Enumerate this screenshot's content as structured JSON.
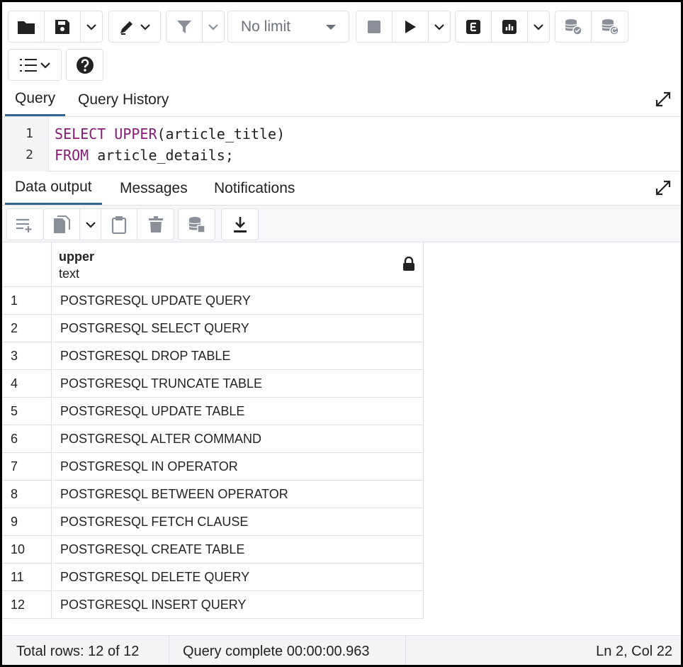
{
  "toolbar": {
    "limit_value": "No limit",
    "icons": [
      "folder-icon",
      "save-icon",
      "chevron-down-icon",
      "edit-pen-icon",
      "filter-icon",
      "stop-icon",
      "play-icon",
      "explain-icon",
      "explain-analyze-icon",
      "commit-icon",
      "rollback-icon",
      "macros-icon",
      "help-icon"
    ]
  },
  "query_tabs": [
    {
      "label": "Query",
      "active": true
    },
    {
      "label": "Query History",
      "active": false
    }
  ],
  "editor": {
    "lines": [
      {
        "number": "1",
        "keyword1": "SELECT",
        "keyword2": "UPPER",
        "rest": "(article_title)"
      },
      {
        "number": "2",
        "keyword1": "FROM",
        "rest": " article_details;"
      }
    ]
  },
  "output_tabs": [
    {
      "label": "Data output",
      "active": true
    },
    {
      "label": "Messages",
      "active": false
    },
    {
      "label": "Notifications",
      "active": false
    }
  ],
  "grid": {
    "column": {
      "name": "upper",
      "type": "text"
    },
    "rows": [
      {
        "num": "1",
        "value": "POSTGRESQL UPDATE QUERY"
      },
      {
        "num": "2",
        "value": "POSTGRESQL SELECT QUERY"
      },
      {
        "num": "3",
        "value": "POSTGRESQL DROP TABLE"
      },
      {
        "num": "4",
        "value": "POSTGRESQL TRUNCATE TABLE"
      },
      {
        "num": "5",
        "value": "POSTGRESQL UPDATE TABLE"
      },
      {
        "num": "6",
        "value": "POSTGRESQL ALTER COMMAND"
      },
      {
        "num": "7",
        "value": "POSTGRESQL IN OPERATOR"
      },
      {
        "num": "8",
        "value": "POSTGRESQL BETWEEN OPERATOR"
      },
      {
        "num": "9",
        "value": "POSTGRESQL FETCH CLAUSE"
      },
      {
        "num": "10",
        "value": "POSTGRESQL CREATE TABLE"
      },
      {
        "num": "11",
        "value": "POSTGRESQL DELETE QUERY"
      },
      {
        "num": "12",
        "value": "POSTGRESQL INSERT QUERY"
      }
    ]
  },
  "status": {
    "total_rows": "Total rows: 12 of 12",
    "query_status": "Query complete 00:00:00.963",
    "cursor": "Ln 2, Col 22"
  },
  "colors": {
    "accent": "#326690",
    "keyword": "#8a1a7a"
  }
}
